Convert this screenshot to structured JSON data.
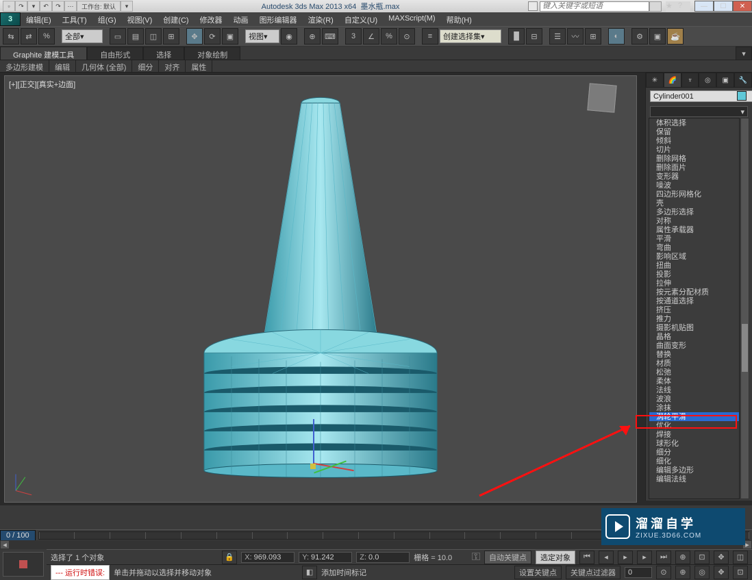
{
  "title": {
    "app": "Autodesk 3ds Max  2013 x64",
    "file": "墨水瓶.max"
  },
  "qab": {
    "workspace_label": "工作台: 默认"
  },
  "search_placeholder": "键入关键字或短语",
  "menus": [
    "编辑(E)",
    "工具(T)",
    "组(G)",
    "视图(V)",
    "创建(C)",
    "修改器",
    "动画",
    "图形编辑器",
    "渲染(R)",
    "自定义(U)",
    "MAXScript(M)",
    "帮助(H)"
  ],
  "toolbar": {
    "all_label": "全部",
    "view_label": "视图",
    "selset_label": "创建选择集"
  },
  "ribbon": {
    "tabs": [
      "Graphite 建模工具",
      "自由形式",
      "选择",
      "对象绘制"
    ],
    "sub": [
      "多边形建模",
      "编辑",
      "几何体 (全部)",
      "细分",
      "对齐",
      "属性"
    ]
  },
  "viewport": {
    "label": "[+][正交][真实+边面]"
  },
  "right_panel": {
    "object_name": "Cylinder001",
    "modifiers": [
      "体积选择",
      "保留",
      "倾斜",
      "切片",
      "删除网格",
      "删除面片",
      "变形器",
      "噪波",
      "四边形网格化",
      "壳",
      "多边形选择",
      "对称",
      "属性承载器",
      "平滑",
      "弯曲",
      "影响区域",
      "扭曲",
      "投影",
      "拉伸",
      "按元素分配材质",
      "按通道选择",
      "挤压",
      "推力",
      "摄影机贴图",
      "晶格",
      "曲面变形",
      "替换",
      "材质",
      "松弛",
      "柔体",
      "法线",
      "波浪",
      "涂抹",
      "涡轮平滑",
      "优化",
      "焊接",
      "球形化",
      "细分",
      "细化",
      "编辑多边形",
      "编辑法线"
    ],
    "selected_index": 33
  },
  "timeline": {
    "frame": "0 / 100"
  },
  "status": {
    "selected": "选择了 1 个对象",
    "hint": "单击并拖动以选择并移动对象",
    "x": "969.093",
    "y": "91.242",
    "z": "0.0",
    "grid": "栅格 = 10.0",
    "add_marker": "添加时间标记",
    "autokey": "自动关键点",
    "selkey": "选定对象",
    "setkey": "设置关键点",
    "keyfilter": "关键点过滤器",
    "error": "--- 运行时错误:"
  },
  "watermark": {
    "t1": "溜溜自学",
    "t2": "ZIXUE.3D66.COM"
  }
}
